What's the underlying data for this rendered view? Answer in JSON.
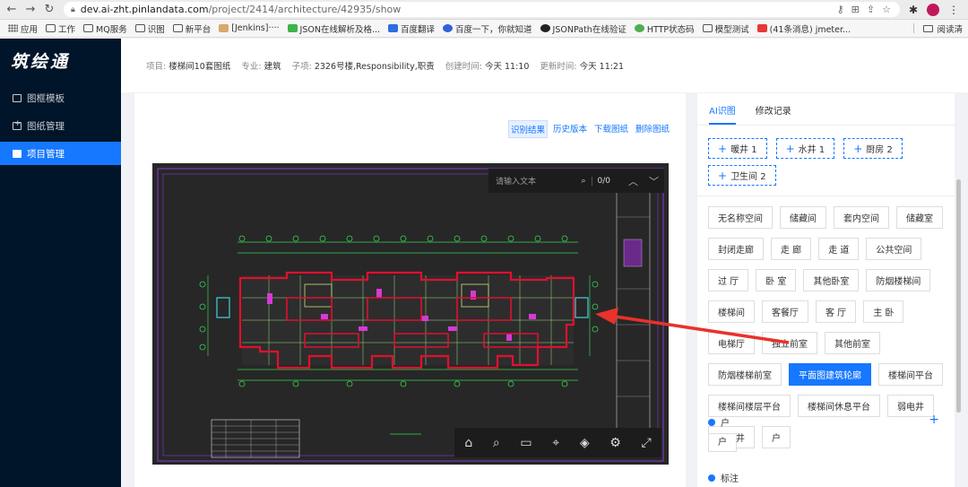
{
  "browser": {
    "url_host": "dev.ai-zht.pinlandata.com",
    "url_path": "/project/2414/architecture/42935/show",
    "bookmarks": [
      "应用",
      "工作",
      "MQ服务",
      "识图",
      "新平台",
      "[Jenkins]····",
      "JSON在线解析及格...",
      "百度翻译",
      "百度一下，你就知道",
      "JSONPath在线验证",
      "HTTP状态码",
      "模型测试",
      "(41条消息) jmeter...",
      "阅读清"
    ]
  },
  "app": {
    "logo": "筑绘通",
    "menu": [
      {
        "label": "图框模板",
        "icon": "frame-icon"
      },
      {
        "label": "图纸管理",
        "icon": "drawing-icon"
      },
      {
        "label": "项目管理",
        "icon": "project-icon"
      }
    ],
    "active_menu": "项目管理"
  },
  "info": {
    "project_label": "项目:",
    "project": "楼梯间10套图纸",
    "major_label": "专业:",
    "major": "建筑",
    "sub_label": "子项:",
    "sub": "2326号楼,Responsibility,职责",
    "created_label": "创建时间:",
    "created": "今天 11:10",
    "updated_label": "更新时间:",
    "updated": "今天 11:21"
  },
  "actions": [
    "识别结果",
    "历史版本",
    "下载图纸",
    "删除图纸"
  ],
  "viewer": {
    "search_placeholder": "请输入文本",
    "search_count": "0/0"
  },
  "right": {
    "tabs": [
      "AI识图",
      "修改记录"
    ],
    "dashed_tags": [
      "暖井 1",
      "水井 1",
      "厨房 2",
      "卫生间 2"
    ],
    "tags": [
      "无名称空间",
      "储藏间",
      "套内空间",
      "储藏室",
      "封闭走廊",
      "走 廊",
      "走 道",
      "公共空间",
      "过 厅",
      "卧 室",
      "其他卧室",
      "防烟楼梯间",
      "楼梯间",
      "客餐厅",
      "客 厅",
      "主 卧",
      "电梯厅",
      "独立前室",
      "其他前室",
      "防烟楼梯前室",
      "平面图建筑轮廓",
      "楼梯间平台",
      "楼梯间楼层平台",
      "楼梯间休息平台",
      "弱电井",
      "强电井",
      "户"
    ],
    "selected_tag": "平面图建筑轮廓",
    "section_hu": "户",
    "hu_tags": [
      "户"
    ],
    "section_biaozhu": "标注"
  },
  "colors": {
    "accent": "#1677ff",
    "sidebar": "#001529",
    "viewer_bg": "#272727"
  }
}
